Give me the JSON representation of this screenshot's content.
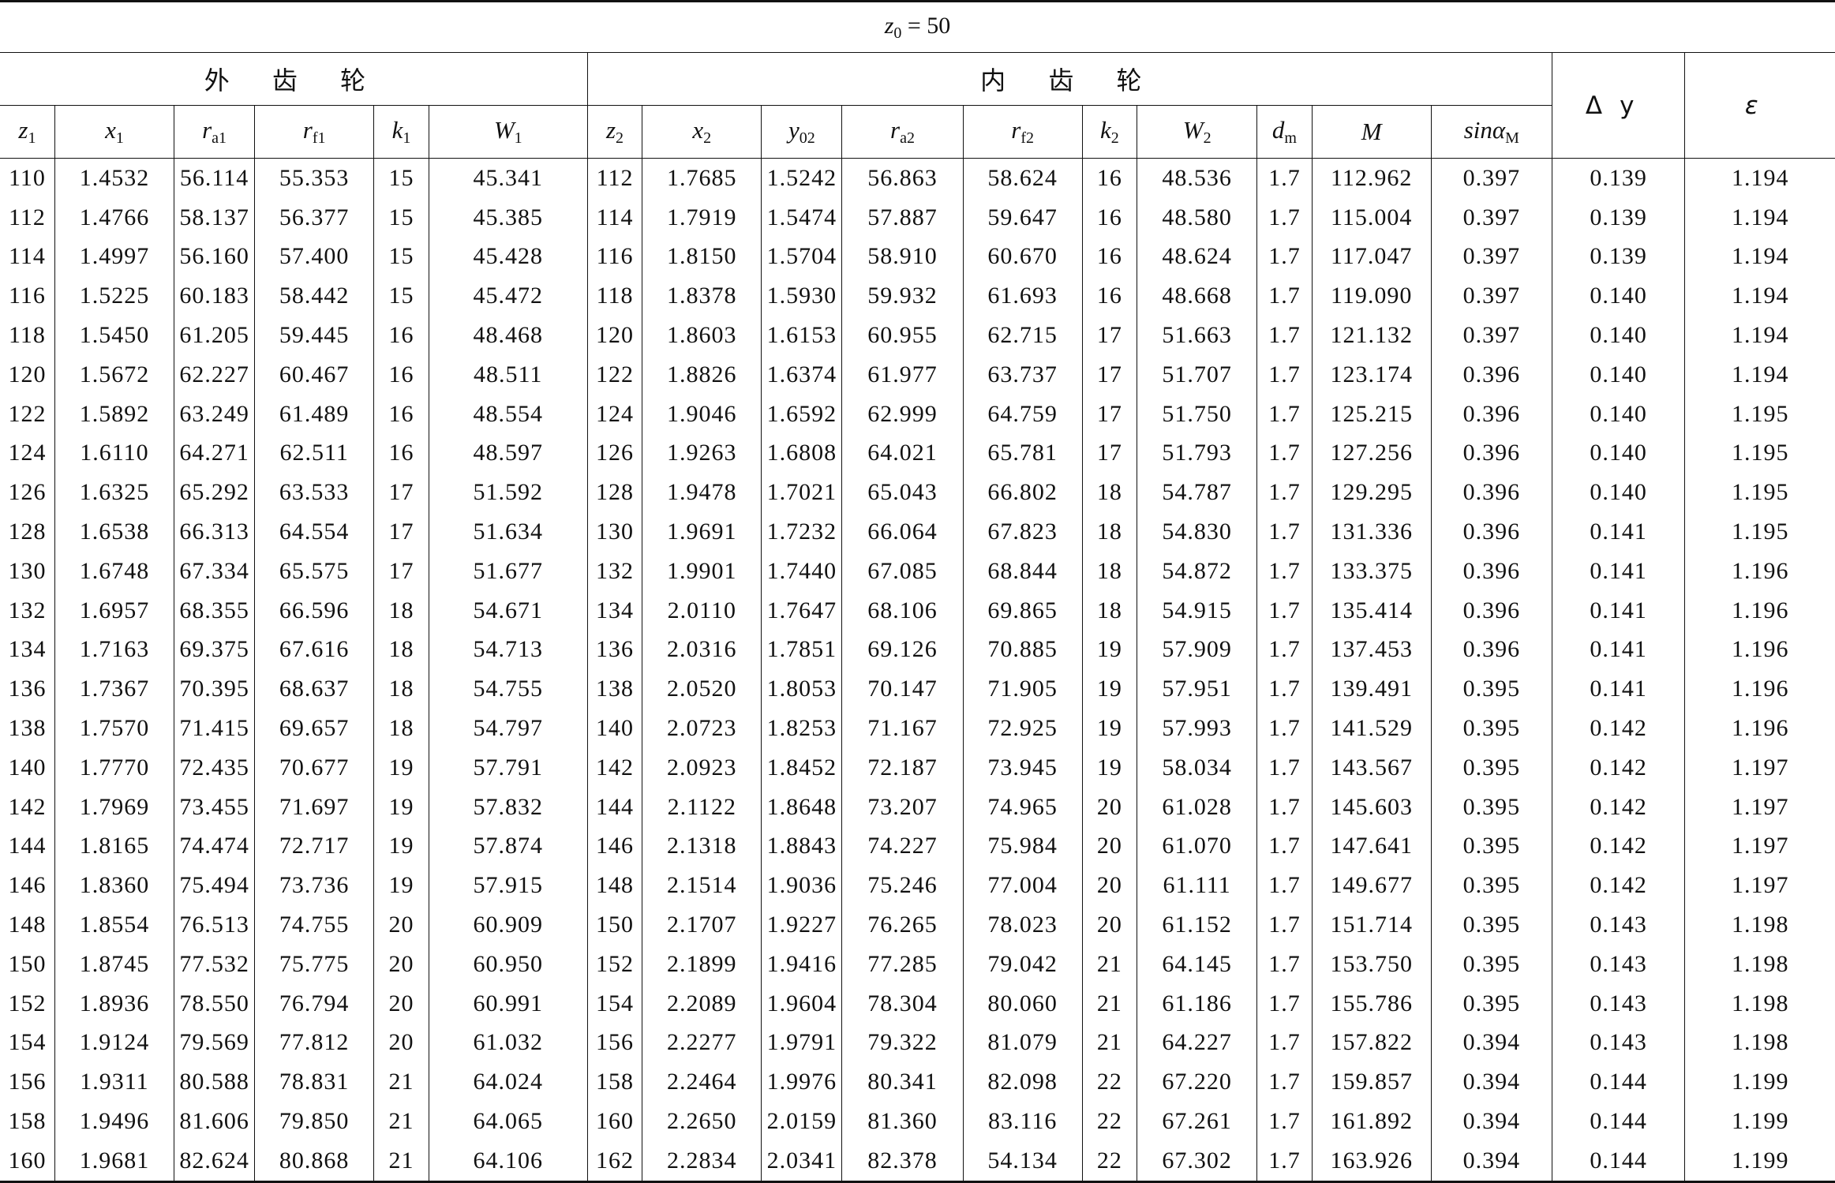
{
  "title": {
    "symbol": "z",
    "sub": "0",
    "rest": " = 50"
  },
  "groups": {
    "external": "外 齿 轮",
    "internal": "内 齿 轮"
  },
  "columns": {
    "z1": {
      "sym": "z",
      "sub": "1"
    },
    "x1": {
      "sym": "x",
      "sub": "1"
    },
    "ra1": {
      "sym": "r",
      "sub": "a1"
    },
    "rf1": {
      "sym": "r",
      "sub": "f1"
    },
    "k1": {
      "sym": "k",
      "sub": "1"
    },
    "W1": {
      "sym": "W",
      "sub": "1"
    },
    "z2": {
      "sym": "z",
      "sub": "2"
    },
    "x2": {
      "sym": "x",
      "sub": "2"
    },
    "y02": {
      "sym": "y",
      "sub": "02"
    },
    "ra2": {
      "sym": "r",
      "sub": "a2"
    },
    "rf2": {
      "sym": "r",
      "sub": "f2"
    },
    "k2": {
      "sym": "k",
      "sub": "2"
    },
    "W2": {
      "sym": "W",
      "sub": "2"
    },
    "dm": {
      "sym": "d",
      "sub": "m"
    },
    "M": {
      "sym": "M",
      "sub": ""
    },
    "sinaM": {
      "sym": "sinα",
      "sub": "M"
    },
    "dy": {
      "sym": "Δy",
      "sub": ""
    },
    "eps": {
      "sym": "ε",
      "sub": ""
    }
  },
  "rows": [
    [
      "110",
      "1.4532",
      "56.114",
      "55.353",
      "15",
      "45.341",
      "112",
      "1.7685",
      "1.5242",
      "56.863",
      "58.624",
      "16",
      "48.536",
      "1.7",
      "112.962",
      "0.397",
      "0.139",
      "1.194"
    ],
    [
      "112",
      "1.4766",
      "58.137",
      "56.377",
      "15",
      "45.385",
      "114",
      "1.7919",
      "1.5474",
      "57.887",
      "59.647",
      "16",
      "48.580",
      "1.7",
      "115.004",
      "0.397",
      "0.139",
      "1.194"
    ],
    [
      "114",
      "1.4997",
      "56.160",
      "57.400",
      "15",
      "45.428",
      "116",
      "1.8150",
      "1.5704",
      "58.910",
      "60.670",
      "16",
      "48.624",
      "1.7",
      "117.047",
      "0.397",
      "0.139",
      "1.194"
    ],
    [
      "116",
      "1.5225",
      "60.183",
      "58.442",
      "15",
      "45.472",
      "118",
      "1.8378",
      "1.5930",
      "59.932",
      "61.693",
      "16",
      "48.668",
      "1.7",
      "119.090",
      "0.397",
      "0.140",
      "1.194"
    ],
    [
      "118",
      "1.5450",
      "61.205",
      "59.445",
      "16",
      "48.468",
      "120",
      "1.8603",
      "1.6153",
      "60.955",
      "62.715",
      "17",
      "51.663",
      "1.7",
      "121.132",
      "0.397",
      "0.140",
      "1.194"
    ],
    [
      "120",
      "1.5672",
      "62.227",
      "60.467",
      "16",
      "48.511",
      "122",
      "1.8826",
      "1.6374",
      "61.977",
      "63.737",
      "17",
      "51.707",
      "1.7",
      "123.174",
      "0.396",
      "0.140",
      "1.194"
    ],
    [
      "122",
      "1.5892",
      "63.249",
      "61.489",
      "16",
      "48.554",
      "124",
      "1.9046",
      "1.6592",
      "62.999",
      "64.759",
      "17",
      "51.750",
      "1.7",
      "125.215",
      "0.396",
      "0.140",
      "1.195"
    ],
    [
      "124",
      "1.6110",
      "64.271",
      "62.511",
      "16",
      "48.597",
      "126",
      "1.9263",
      "1.6808",
      "64.021",
      "65.781",
      "17",
      "51.793",
      "1.7",
      "127.256",
      "0.396",
      "0.140",
      "1.195"
    ],
    [
      "126",
      "1.6325",
      "65.292",
      "63.533",
      "17",
      "51.592",
      "128",
      "1.9478",
      "1.7021",
      "65.043",
      "66.802",
      "18",
      "54.787",
      "1.7",
      "129.295",
      "0.396",
      "0.140",
      "1.195"
    ],
    [
      "128",
      "1.6538",
      "66.313",
      "64.554",
      "17",
      "51.634",
      "130",
      "1.9691",
      "1.7232",
      "66.064",
      "67.823",
      "18",
      "54.830",
      "1.7",
      "131.336",
      "0.396",
      "0.141",
      "1.195"
    ],
    [
      "130",
      "1.6748",
      "67.334",
      "65.575",
      "17",
      "51.677",
      "132",
      "1.9901",
      "1.7440",
      "67.085",
      "68.844",
      "18",
      "54.872",
      "1.7",
      "133.375",
      "0.396",
      "0.141",
      "1.196"
    ],
    [
      "132",
      "1.6957",
      "68.355",
      "66.596",
      "18",
      "54.671",
      "134",
      "2.0110",
      "1.7647",
      "68.106",
      "69.865",
      "18",
      "54.915",
      "1.7",
      "135.414",
      "0.396",
      "0.141",
      "1.196"
    ],
    [
      "134",
      "1.7163",
      "69.375",
      "67.616",
      "18",
      "54.713",
      "136",
      "2.0316",
      "1.7851",
      "69.126",
      "70.885",
      "19",
      "57.909",
      "1.7",
      "137.453",
      "0.396",
      "0.141",
      "1.196"
    ],
    [
      "136",
      "1.7367",
      "70.395",
      "68.637",
      "18",
      "54.755",
      "138",
      "2.0520",
      "1.8053",
      "70.147",
      "71.905",
      "19",
      "57.951",
      "1.7",
      "139.491",
      "0.395",
      "0.141",
      "1.196"
    ],
    [
      "138",
      "1.7570",
      "71.415",
      "69.657",
      "18",
      "54.797",
      "140",
      "2.0723",
      "1.8253",
      "71.167",
      "72.925",
      "19",
      "57.993",
      "1.7",
      "141.529",
      "0.395",
      "0.142",
      "1.196"
    ],
    [
      "140",
      "1.7770",
      "72.435",
      "70.677",
      "19",
      "57.791",
      "142",
      "2.0923",
      "1.8452",
      "72.187",
      "73.945",
      "19",
      "58.034",
      "1.7",
      "143.567",
      "0.395",
      "0.142",
      "1.197"
    ],
    [
      "142",
      "1.7969",
      "73.455",
      "71.697",
      "19",
      "57.832",
      "144",
      "2.1122",
      "1.8648",
      "73.207",
      "74.965",
      "20",
      "61.028",
      "1.7",
      "145.603",
      "0.395",
      "0.142",
      "1.197"
    ],
    [
      "144",
      "1.8165",
      "74.474",
      "72.717",
      "19",
      "57.874",
      "146",
      "2.1318",
      "1.8843",
      "74.227",
      "75.984",
      "20",
      "61.070",
      "1.7",
      "147.641",
      "0.395",
      "0.142",
      "1.197"
    ],
    [
      "146",
      "1.8360",
      "75.494",
      "73.736",
      "19",
      "57.915",
      "148",
      "2.1514",
      "1.9036",
      "75.246",
      "77.004",
      "20",
      "61.111",
      "1.7",
      "149.677",
      "0.395",
      "0.142",
      "1.197"
    ],
    [
      "148",
      "1.8554",
      "76.513",
      "74.755",
      "20",
      "60.909",
      "150",
      "2.1707",
      "1.9227",
      "76.265",
      "78.023",
      "20",
      "61.152",
      "1.7",
      "151.714",
      "0.395",
      "0.143",
      "1.198"
    ],
    [
      "150",
      "1.8745",
      "77.532",
      "75.775",
      "20",
      "60.950",
      "152",
      "2.1899",
      "1.9416",
      "77.285",
      "79.042",
      "21",
      "64.145",
      "1.7",
      "153.750",
      "0.395",
      "0.143",
      "1.198"
    ],
    [
      "152",
      "1.8936",
      "78.550",
      "76.794",
      "20",
      "60.991",
      "154",
      "2.2089",
      "1.9604",
      "78.304",
      "80.060",
      "21",
      "61.186",
      "1.7",
      "155.786",
      "0.395",
      "0.143",
      "1.198"
    ],
    [
      "154",
      "1.9124",
      "79.569",
      "77.812",
      "20",
      "61.032",
      "156",
      "2.2277",
      "1.9791",
      "79.322",
      "81.079",
      "21",
      "64.227",
      "1.7",
      "157.822",
      "0.394",
      "0.143",
      "1.198"
    ],
    [
      "156",
      "1.9311",
      "80.588",
      "78.831",
      "21",
      "64.024",
      "158",
      "2.2464",
      "1.9976",
      "80.341",
      "82.098",
      "22",
      "67.220",
      "1.7",
      "159.857",
      "0.394",
      "0.144",
      "1.199"
    ],
    [
      "158",
      "1.9496",
      "81.606",
      "79.850",
      "21",
      "64.065",
      "160",
      "2.2650",
      "2.0159",
      "81.360",
      "83.116",
      "22",
      "67.261",
      "1.7",
      "161.892",
      "0.394",
      "0.144",
      "1.199"
    ],
    [
      "160",
      "1.9681",
      "82.624",
      "80.868",
      "21",
      "64.106",
      "162",
      "2.2834",
      "2.0341",
      "82.378",
      "54.134",
      "22",
      "67.302",
      "1.7",
      "163.926",
      "0.394",
      "0.144",
      "1.199"
    ]
  ]
}
